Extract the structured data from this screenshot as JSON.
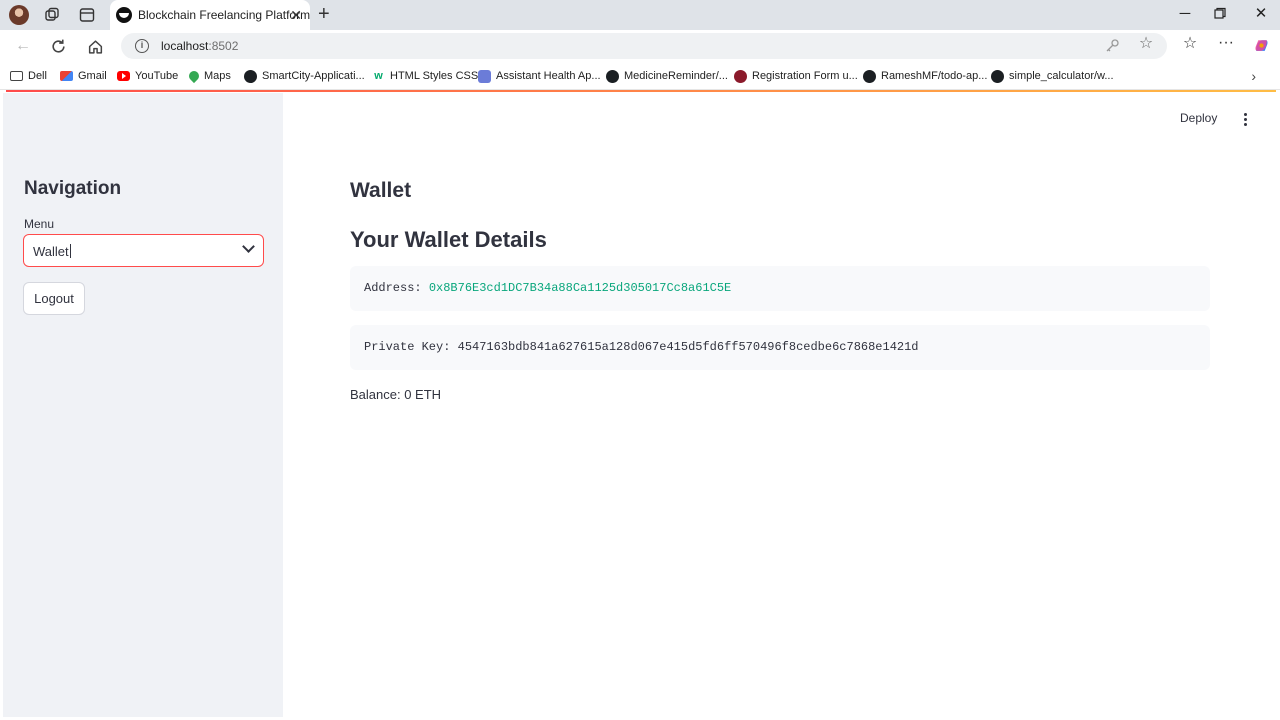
{
  "browser": {
    "tab": {
      "title": "Blockchain Freelancing Platform"
    },
    "url": {
      "host": "localhost",
      "port": ":8502"
    },
    "bookmarks": [
      {
        "label": "Dell",
        "icon": "folder-icon"
      },
      {
        "label": "Gmail",
        "icon": "gmail-icon"
      },
      {
        "label": "YouTube",
        "icon": "youtube-icon"
      },
      {
        "label": "Maps",
        "icon": "maps-icon"
      },
      {
        "label": "SmartCity-Applicati...",
        "icon": "github-icon"
      },
      {
        "label": "HTML Styles CSS",
        "icon": "w3schools-icon"
      },
      {
        "label": "Assistant Health Ap...",
        "icon": "app-icon"
      },
      {
        "label": "MedicineReminder/...",
        "icon": "github-icon"
      },
      {
        "label": "Registration Form u...",
        "icon": "form-icon"
      },
      {
        "label": "RameshMF/todo-ap...",
        "icon": "github-icon"
      },
      {
        "label": "simple_calculator/w...",
        "icon": "github-icon"
      }
    ]
  },
  "app": {
    "deploy_label": "Deploy",
    "accent_color": "#ff4b4b",
    "sidebar": {
      "title": "Navigation",
      "menu_label": "Menu",
      "menu_selected": "Wallet",
      "logout_label": "Logout"
    },
    "main": {
      "title": "Wallet",
      "subtitle": "Your Wallet Details",
      "address_label": "Address: ",
      "address_value": "0x8B76E3cd1DC7B34a88Ca1125d305017Cc8a61C5E",
      "private_key_label": "Private Key: ",
      "private_key_value": "4547163bdb841a627615a128d067e415d5fd6ff570496f8cedbe6c7868e1421d",
      "balance_text": "Balance: 0 ETH"
    }
  }
}
